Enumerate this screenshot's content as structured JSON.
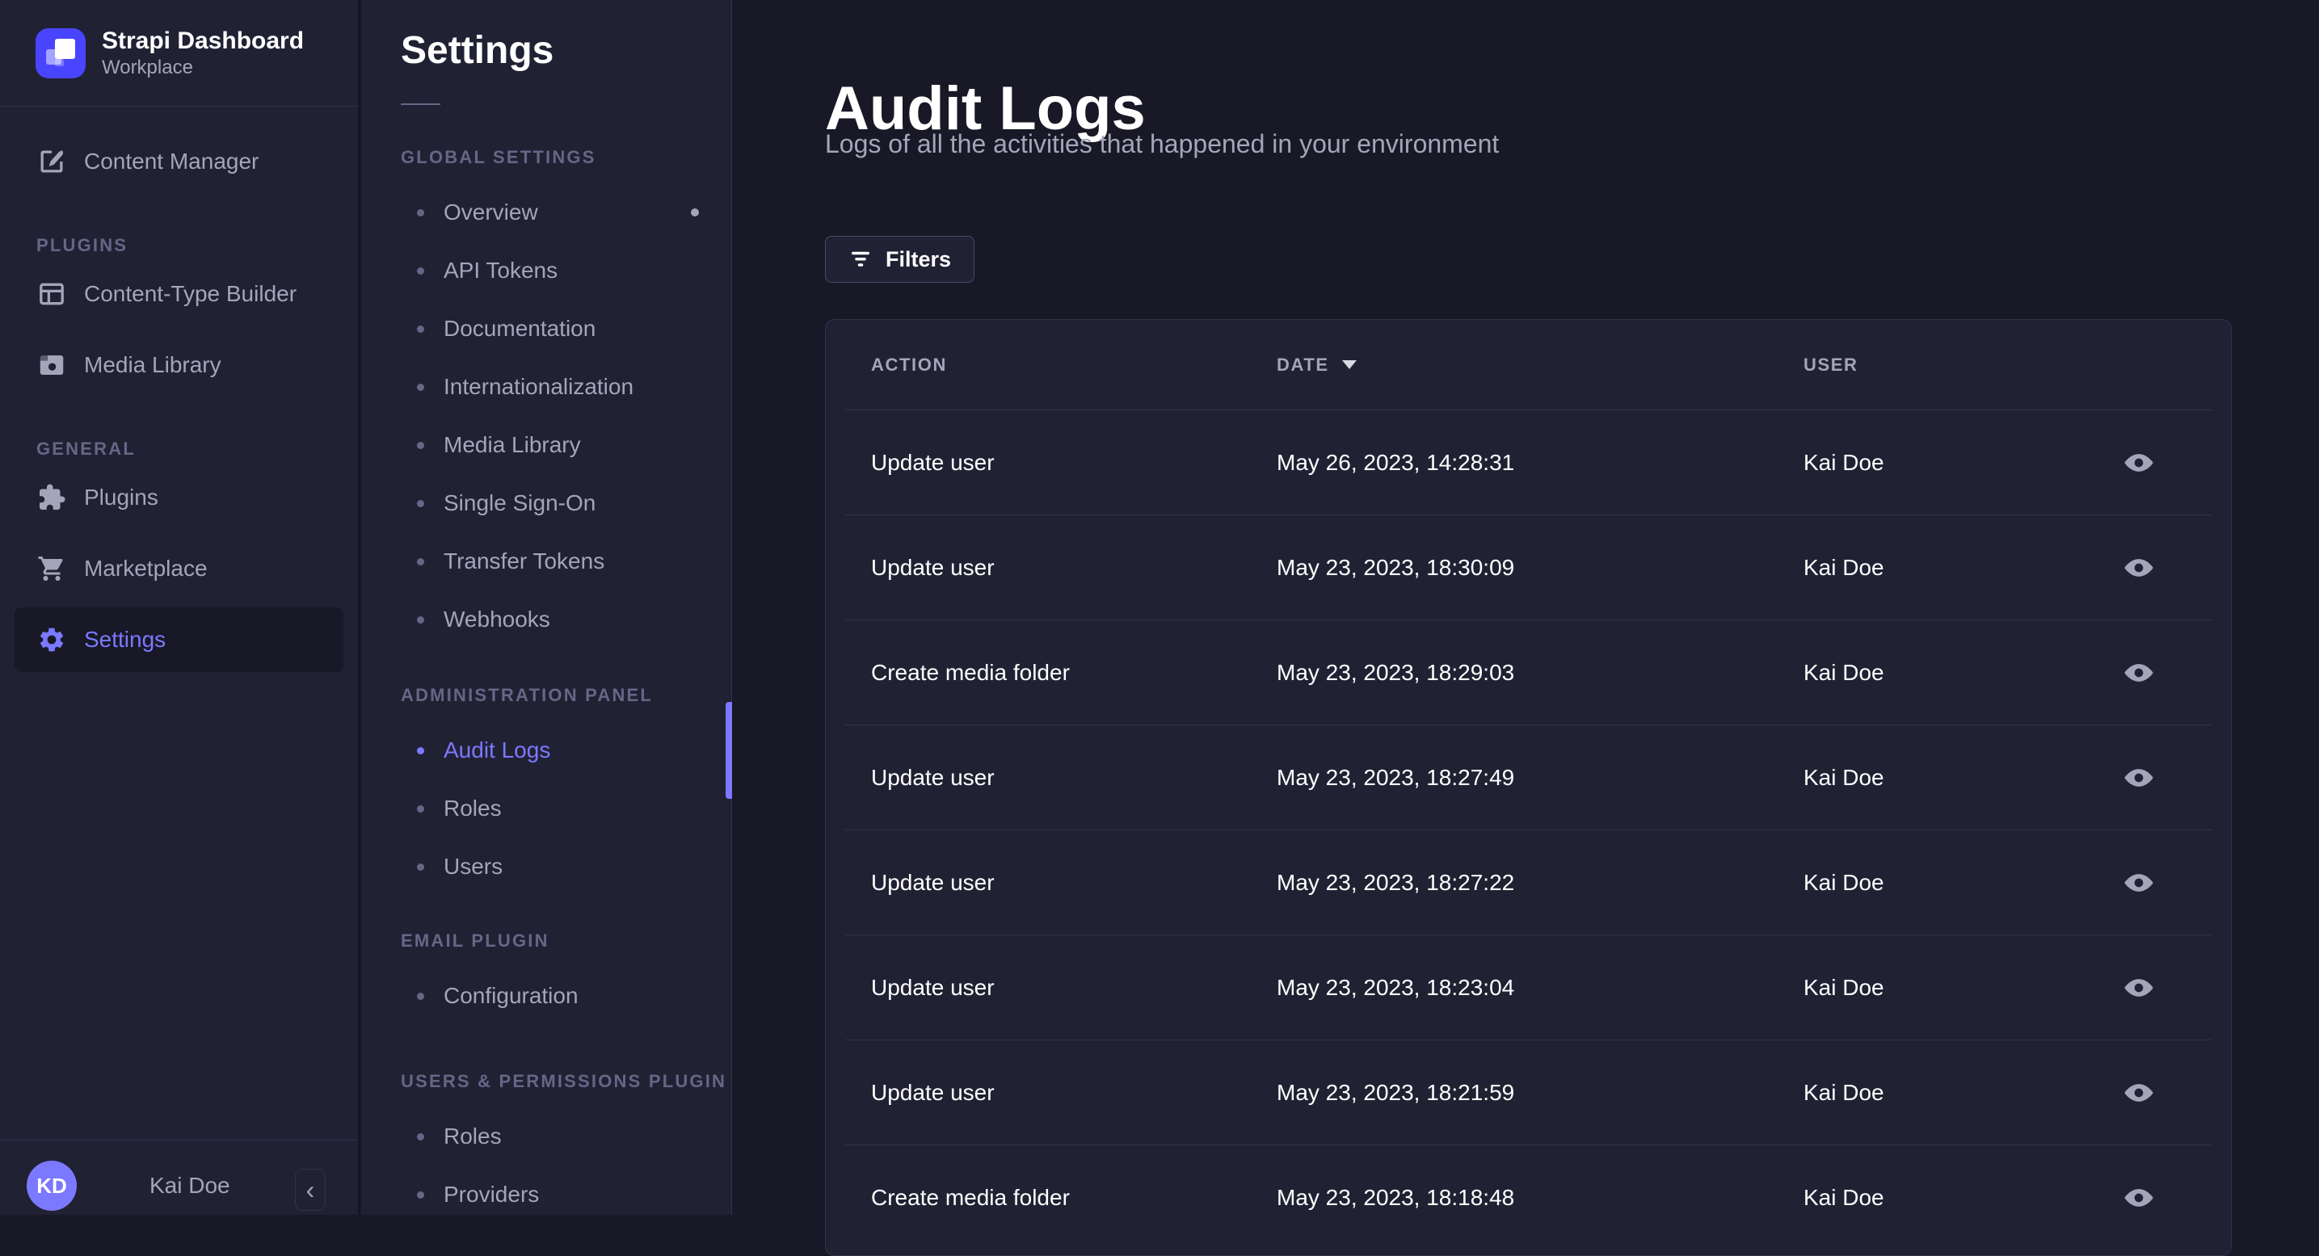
{
  "colors": {
    "accent": "#7b79ff",
    "logo_purple": "#4945ff",
    "panel_bg": "#212134",
    "app_bg": "#181826",
    "muted_text": "#a5a5ba",
    "faint_text": "#666687",
    "border": "#32324d"
  },
  "sidebar": {
    "brand": {
      "title": "Strapi Dashboard",
      "subtitle": "Workplace",
      "logo_icon": "strapi-logo"
    },
    "content_manager": {
      "label": "Content Manager",
      "icon": "feather-pen-icon"
    },
    "sections": [
      {
        "label": "PLUGINS",
        "items": [
          {
            "label": "Content-Type Builder",
            "icon": "layout-icon"
          },
          {
            "label": "Media Library",
            "icon": "picture-icon"
          }
        ]
      },
      {
        "label": "GENERAL",
        "items": [
          {
            "label": "Plugins",
            "icon": "puzzle-icon"
          },
          {
            "label": "Marketplace",
            "icon": "cart-icon"
          },
          {
            "label": "Settings",
            "icon": "gear-icon",
            "active": true
          }
        ]
      }
    ],
    "user": {
      "initials": "KD",
      "name": "Kai Doe",
      "collapse_glyph": "‹"
    }
  },
  "settings_nav": {
    "title": "Settings",
    "sections": [
      {
        "label": "GLOBAL SETTINGS",
        "items": [
          {
            "label": "Overview",
            "has_notification_dot": true
          },
          {
            "label": "API Tokens"
          },
          {
            "label": "Documentation"
          },
          {
            "label": "Internationalization"
          },
          {
            "label": "Media Library"
          },
          {
            "label": "Single Sign-On"
          },
          {
            "label": "Transfer Tokens"
          },
          {
            "label": "Webhooks"
          }
        ]
      },
      {
        "label": "ADMINISTRATION PANEL",
        "items": [
          {
            "label": "Audit Logs",
            "active": true
          },
          {
            "label": "Roles"
          },
          {
            "label": "Users"
          }
        ]
      },
      {
        "label": "EMAIL PLUGIN",
        "items": [
          {
            "label": "Configuration"
          }
        ]
      },
      {
        "label": "USERS & PERMISSIONS PLUGIN",
        "items": [
          {
            "label": "Roles"
          },
          {
            "label": "Providers"
          }
        ]
      }
    ]
  },
  "main": {
    "title": "Audit Logs",
    "subtitle": "Logs of all the activities that happened in your environment",
    "filters_button": {
      "label": "Filters",
      "icon": "filter-icon"
    },
    "table": {
      "headers": {
        "action": "ACTION",
        "date": "DATE",
        "user": "USER",
        "date_sort_icon": "caret-down-icon",
        "row_action_icon": "eye-icon"
      },
      "rows": [
        {
          "action": "Update user",
          "date": "May 26, 2023, 14:28:31",
          "user": "Kai Doe"
        },
        {
          "action": "Update user",
          "date": "May 23, 2023, 18:30:09",
          "user": "Kai Doe"
        },
        {
          "action": "Create media folder",
          "date": "May 23, 2023, 18:29:03",
          "user": "Kai Doe"
        },
        {
          "action": "Update user",
          "date": "May 23, 2023, 18:27:49",
          "user": "Kai Doe"
        },
        {
          "action": "Update user",
          "date": "May 23, 2023, 18:27:22",
          "user": "Kai Doe"
        },
        {
          "action": "Update user",
          "date": "May 23, 2023, 18:23:04",
          "user": "Kai Doe"
        },
        {
          "action": "Update user",
          "date": "May 23, 2023, 18:21:59",
          "user": "Kai Doe"
        },
        {
          "action": "Create media folder",
          "date": "May 23, 2023, 18:18:48",
          "user": "Kai Doe"
        }
      ]
    }
  }
}
